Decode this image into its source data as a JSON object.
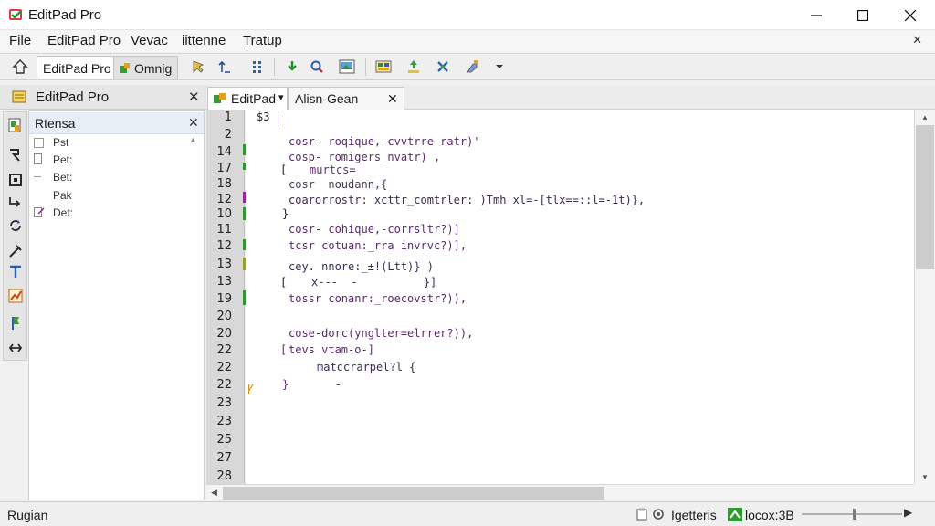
{
  "window": {
    "title": "EditPad Pro"
  },
  "menu": {
    "items": [
      "File",
      "EditPad Pro",
      "Vevac",
      "iittenne",
      "Tratup"
    ],
    "close_glyph": "✕"
  },
  "toolbar": {
    "tab_active": "EditPad Pro",
    "tab_other": "Omnig",
    "icons": [
      "home-icon",
      "cursor-icon",
      "arrow-up-icon",
      "grid-icon",
      "download-icon",
      "search-icon",
      "image-icon",
      "layout-icon",
      "move-icon",
      "cross-icon",
      "puzzle-icon",
      "dropdown-icon"
    ]
  },
  "left_panel": {
    "title": "EditPad Pro",
    "close_glyph": "✕",
    "file_list_title": "Rtensa",
    "file_list_close": "✕",
    "files": [
      {
        "label": "Pst"
      },
      {
        "label": "Pet:"
      },
      {
        "label": "Bet:"
      },
      {
        "label": "Pak"
      },
      {
        "label": "Det:"
      }
    ]
  },
  "editor": {
    "tabs": [
      {
        "label": "EditPad",
        "dropdown": "▾"
      },
      {
        "label": "Alisn-Gean",
        "close": "✕"
      }
    ],
    "lines": [
      {
        "num": "1",
        "code": "$3"
      },
      {
        "num": "2",
        "code": "cosr- roqique,-cvvtrre-ratr)'"
      },
      {
        "num": "14",
        "code": "cosp- romigers_nvatr) ,"
      },
      {
        "num": "17",
        "code": "murtcs="
      },
      {
        "num": "18",
        "code": "cosr  noudann,{"
      },
      {
        "num": "12",
        "code": "coarorrostr: xcttr_comtrler: )Tmh xl=-[tlx==::l=-1t)},"
      },
      {
        "num": "10",
        "code": "}"
      },
      {
        "num": "11",
        "code": "cosr- cohique,-corrsltr?)]"
      },
      {
        "num": "12",
        "code": "tcsr cotuan:_rra invrvc?)],"
      },
      {
        "num": "13",
        "code": "cey. nnore:_±!(Ltt)} )"
      },
      {
        "num": "13",
        "code": "x---  -          }]"
      },
      {
        "num": "19",
        "code": "tossr conanr:_roecovstr?)),"
      },
      {
        "num": "20",
        "code": ""
      },
      {
        "num": "20",
        "code": "cose-dorc(ynglter=elrrer?)),"
      },
      {
        "num": "22",
        "code": "tevs vtam-o-]"
      },
      {
        "num": "22",
        "code": "matccrarpel?l {"
      },
      {
        "num": "22",
        "code": "}       -"
      },
      {
        "num": "23",
        "code": ""
      },
      {
        "num": "23",
        "code": ""
      },
      {
        "num": "25",
        "code": ""
      },
      {
        "num": "27",
        "code": ""
      },
      {
        "num": "28",
        "code": ""
      }
    ]
  },
  "status": {
    "left": "Rugian",
    "mid_text": "Igetteris",
    "right_text": "locox:3B"
  },
  "colors": {
    "accent_green": "#2e9a2e",
    "accent_purple": "#a020a0",
    "code_text": "#6a2a7a",
    "code_secondary": "#3a3a3a"
  }
}
